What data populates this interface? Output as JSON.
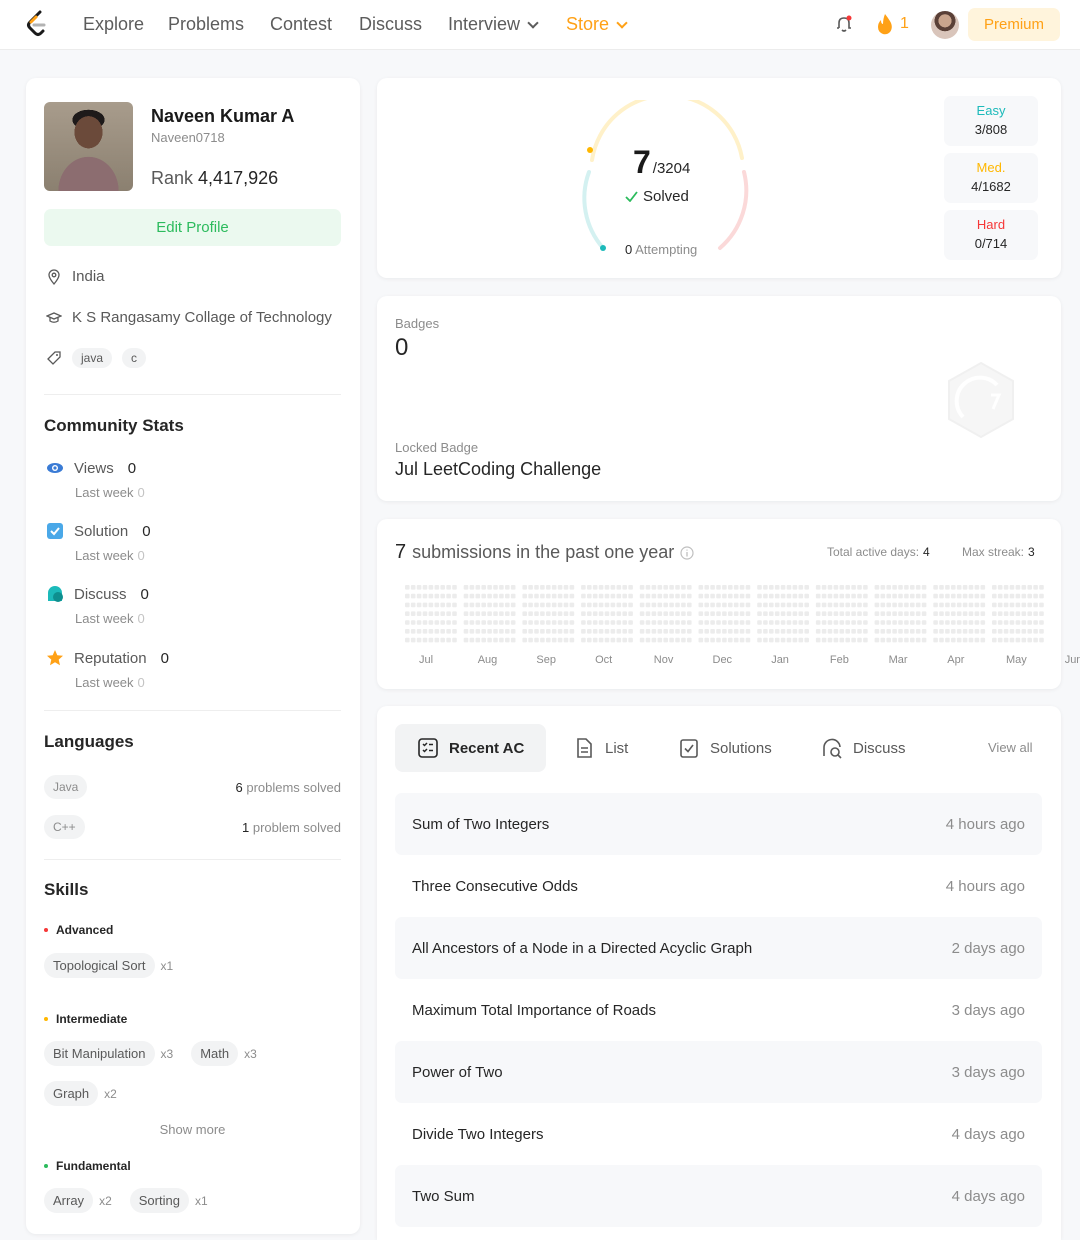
{
  "nav": {
    "links": [
      "Explore",
      "Problems",
      "Contest",
      "Discuss",
      "Interview",
      "Store"
    ],
    "streak": "1",
    "premium": "Premium"
  },
  "profile": {
    "name": "Naveen Kumar A",
    "username": "Naveen0718",
    "rank_label": "Rank",
    "rank": "4,417,926",
    "edit_label": "Edit Profile",
    "location": "India",
    "school": "K S Rangasamy Collage of Technology",
    "tags": [
      "java",
      "c"
    ]
  },
  "community": {
    "title": "Community Stats",
    "items": [
      {
        "label": "Views",
        "value": "0",
        "sub_label": "Last week",
        "sub_value": "0"
      },
      {
        "label": "Solution",
        "value": "0",
        "sub_label": "Last week",
        "sub_value": "0"
      },
      {
        "label": "Discuss",
        "value": "0",
        "sub_label": "Last week",
        "sub_value": "0"
      },
      {
        "label": "Reputation",
        "value": "0",
        "sub_label": "Last week",
        "sub_value": "0"
      }
    ]
  },
  "languages": {
    "title": "Languages",
    "items": [
      {
        "name": "Java",
        "count": "6",
        "suffix": "problems solved"
      },
      {
        "name": "C++",
        "count": "1",
        "suffix": "problem solved"
      }
    ]
  },
  "skills": {
    "title": "Skills",
    "advanced": {
      "label": "Advanced",
      "items": [
        {
          "name": "Topological Sort",
          "count": "x1"
        }
      ]
    },
    "intermediate": {
      "label": "Intermediate",
      "items": [
        {
          "name": "Bit Manipulation",
          "count": "x3"
        },
        {
          "name": "Math",
          "count": "x3"
        },
        {
          "name": "Graph",
          "count": "x2"
        }
      ]
    },
    "show_more": "Show more",
    "fundamental": {
      "label": "Fundamental",
      "items": [
        {
          "name": "Array",
          "count": "x2"
        },
        {
          "name": "Sorting",
          "count": "x1"
        }
      ]
    }
  },
  "solved": {
    "count": "7",
    "total": "/3204",
    "label": "Solved",
    "attempting_count": "0",
    "attempting_label": "Attempting",
    "easy": {
      "label": "Easy",
      "value": "3/808"
    },
    "medium": {
      "label": "Med.",
      "value": "4/1682"
    },
    "hard": {
      "label": "Hard",
      "value": "0/714"
    }
  },
  "badges": {
    "label": "Badges",
    "count": "0",
    "locked_label": "Locked Badge",
    "locked_name": "Jul LeetCoding Challenge"
  },
  "submissions": {
    "count": "7",
    "text": "submissions in the past one year",
    "active_label": "Total active days:",
    "active_value": "4",
    "streak_label": "Max streak:",
    "streak_value": "3",
    "months": [
      "Jul",
      "Aug",
      "Sep",
      "Oct",
      "Nov",
      "Dec",
      "Jan",
      "Feb",
      "Mar",
      "Apr",
      "May",
      "Jun"
    ]
  },
  "recent": {
    "tabs": [
      "Recent AC",
      "List",
      "Solutions",
      "Discuss"
    ],
    "view_all": "View all",
    "items": [
      {
        "title": "Sum of Two Integers",
        "ago": "4 hours ago"
      },
      {
        "title": "Three Consecutive Odds",
        "ago": "4 hours ago"
      },
      {
        "title": "All Ancestors of a Node in a Directed Acyclic Graph",
        "ago": "2 days ago"
      },
      {
        "title": "Maximum Total Importance of Roads",
        "ago": "3 days ago"
      },
      {
        "title": "Power of Two",
        "ago": "3 days ago"
      },
      {
        "title": "Divide Two Integers",
        "ago": "4 days ago"
      },
      {
        "title": "Two Sum",
        "ago": "4 days ago"
      }
    ]
  },
  "colors": {
    "accent": "#ffa116",
    "easy": "#1cbaba",
    "medium": "#ffb700",
    "hard": "#f63737",
    "green": "#2cbb5d"
  }
}
